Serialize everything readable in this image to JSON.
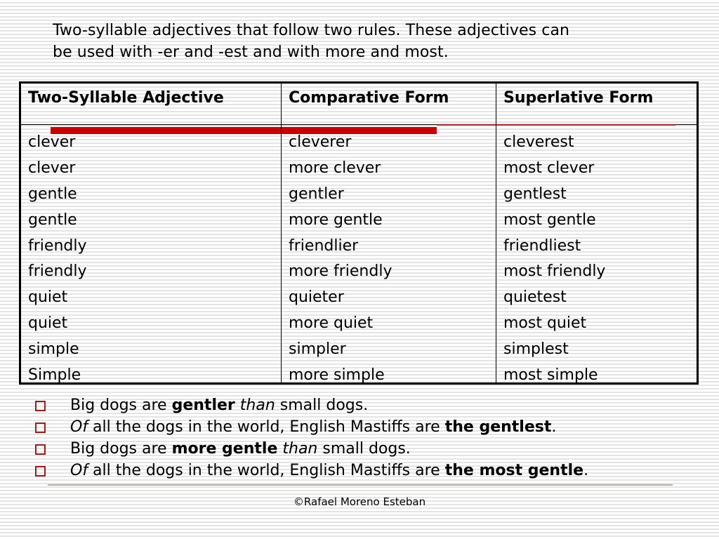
{
  "intro": {
    "line1": "Two-syllable adjectives that follow two rules. These adjectives can",
    "line2": "be used with -er and -est and with more and most."
  },
  "table": {
    "headers": [
      "Two-Syllable Adjective",
      "Comparative Form",
      "Superlative Form"
    ],
    "rows": [
      [
        "clever",
        "cleverer",
        "cleverest"
      ],
      [
        "clever",
        "more clever",
        "most clever"
      ],
      [
        "gentle",
        "gentler",
        "gentlest"
      ],
      [
        "gentle",
        "more gentle",
        "most gentle"
      ],
      [
        "friendly",
        "friendlier",
        "friendliest"
      ],
      [
        "friendly",
        "more friendly",
        "most friendly"
      ],
      [
        "quiet",
        "quieter",
        "quietest"
      ],
      [
        "quiet",
        "more quiet",
        "most quiet"
      ],
      [
        "simple",
        "simpler",
        "simplest"
      ],
      [
        "Simple",
        "more simple",
        "most simple"
      ]
    ]
  },
  "bullets": [
    [
      {
        "t": "Big dogs are ",
        "s": "n"
      },
      {
        "t": "gentler",
        "s": "b"
      },
      {
        "t": " ",
        "s": "n"
      },
      {
        "t": "than",
        "s": "i"
      },
      {
        "t": " small dogs.",
        "s": "n"
      }
    ],
    [
      {
        "t": "Of",
        "s": "i"
      },
      {
        "t": " all the dogs in the world, English Mastiffs are ",
        "s": "n"
      },
      {
        "t": "the gentlest",
        "s": "b"
      },
      {
        "t": ".",
        "s": "n"
      }
    ],
    [
      {
        "t": "Big dogs are ",
        "s": "n"
      },
      {
        "t": "more gentle",
        "s": "b"
      },
      {
        "t": " ",
        "s": "n"
      },
      {
        "t": "than",
        "s": "i"
      },
      {
        "t": " small dogs.",
        "s": "n"
      }
    ],
    [
      {
        "t": "Of",
        "s": "i"
      },
      {
        "t": " all the dogs in the world, English Mastiffs are ",
        "s": "n"
      },
      {
        "t": "the most gentle",
        "s": "b"
      },
      {
        "t": ".",
        "s": "n"
      }
    ]
  ],
  "footer": "©Rafael Moreno Esteban",
  "colors": {
    "accent_red": "#cc0000",
    "bullet_box": "#9c1c1c"
  }
}
